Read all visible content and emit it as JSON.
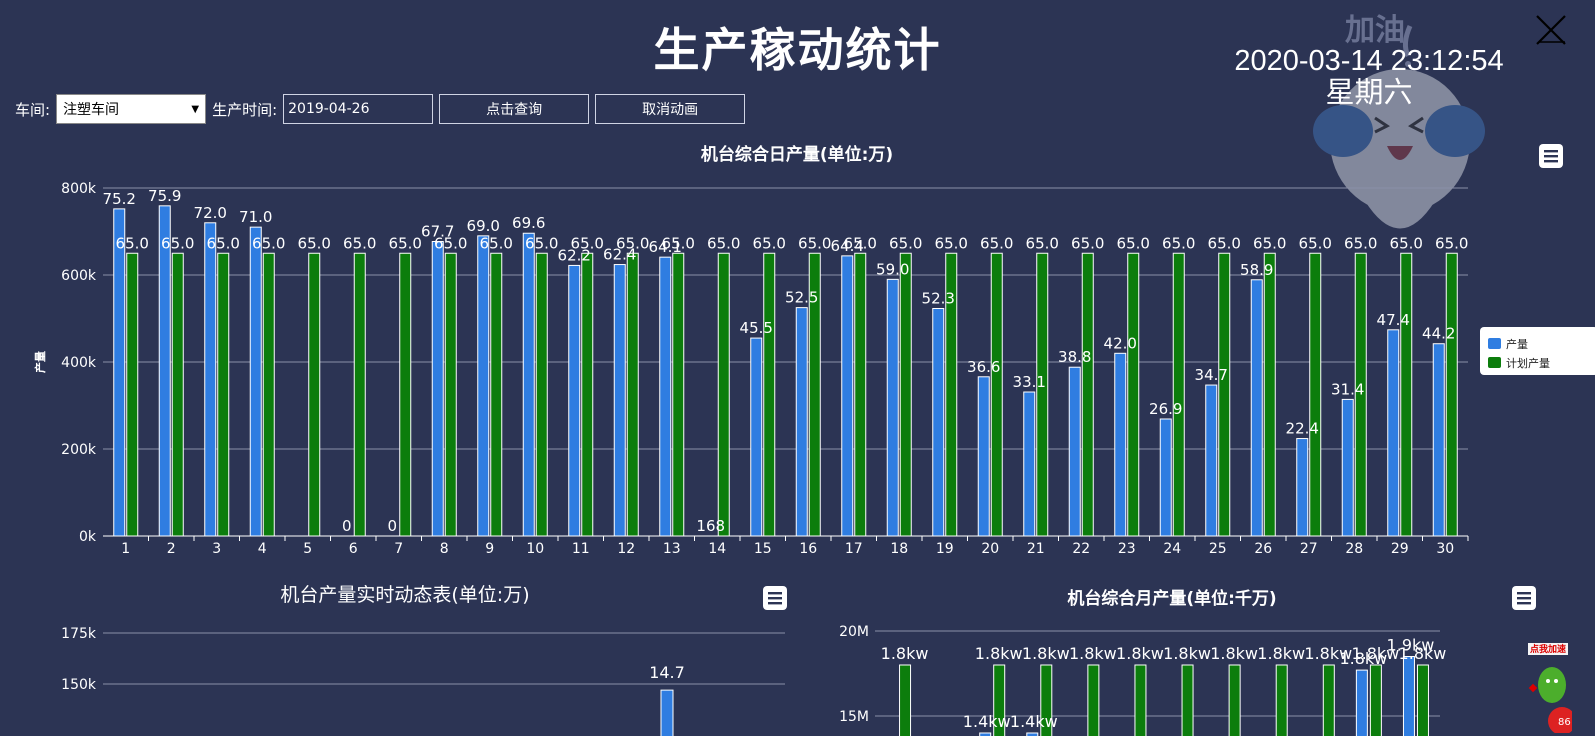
{
  "page": {
    "title": "生产稼动统计",
    "datetime": "2020-03-14 23:12:54",
    "weekday": "星期六"
  },
  "mascot": {
    "text": "加油"
  },
  "toolbar": {
    "workshop_label": "车间:",
    "workshop_value": "注塑车间",
    "date_label": "生产时间:",
    "date_value": "2019-04-26",
    "query_label": "点击查询",
    "cancel_label": "取消动画"
  },
  "ad_badge": {
    "text": "点我加速",
    "number": "86"
  },
  "colors": {
    "background": "#2c3454",
    "output": "#2f7de1",
    "plan": "#0c7d0c",
    "grid": "#8a90a8"
  },
  "chart_data": [
    {
      "type": "bar",
      "title": "机台综合日产量(单位:万)",
      "ylabel": "产量",
      "ylim": [
        0,
        800000
      ],
      "yticks": [
        "0k",
        "200k",
        "400k",
        "600k",
        "800k"
      ],
      "categories": [
        "1",
        "2",
        "3",
        "4",
        "5",
        "6",
        "7",
        "8",
        "9",
        "10",
        "11",
        "12",
        "13",
        "14",
        "15",
        "16",
        "17",
        "18",
        "19",
        "20",
        "21",
        "22",
        "23",
        "24",
        "25",
        "26",
        "27",
        "28",
        "29",
        "30"
      ],
      "legend_position": "right",
      "series": [
        {
          "name": "产量",
          "values": [
            752000,
            759000,
            720000,
            710000,
            0,
            0,
            0,
            677000,
            690000,
            696000,
            622000,
            624000,
            641000,
            168,
            455000,
            525000,
            644000,
            590000,
            523000,
            366000,
            331000,
            388000,
            420000,
            269000,
            347000,
            589000,
            224000,
            314000,
            474000,
            442000
          ],
          "labels": [
            "75.2",
            "75.9",
            "72.0",
            "71.0",
            "",
            "0",
            "0",
            "67.7",
            "69.0",
            "69.6",
            "62.2",
            "62.4",
            "64.1",
            "168",
            "45.5",
            "52.5",
            "64.4",
            "59.0",
            "52.3",
            "36.6",
            "33.1",
            "38.8",
            "42.0",
            "26.9",
            "34.7",
            "58.9",
            "22.4",
            "31.4",
            "47.4",
            "44.2"
          ]
        },
        {
          "name": "计划产量",
          "values": [
            650000,
            650000,
            650000,
            650000,
            650000,
            650000,
            650000,
            650000,
            650000,
            650000,
            650000,
            650000,
            650000,
            650000,
            650000,
            650000,
            650000,
            650000,
            650000,
            650000,
            650000,
            650000,
            650000,
            650000,
            650000,
            650000,
            650000,
            650000,
            650000,
            650000
          ],
          "labels": [
            "65.0",
            "65.0",
            "65.0",
            "65.0",
            "65.0",
            "65.0",
            "65.0",
            "65.0",
            "65.0",
            "65.0",
            "65.0",
            "65.0",
            "65.0",
            "65.0",
            "65.0",
            "65.0",
            "65.0",
            "65.0",
            "65.0",
            "65.0",
            "65.0",
            "65.0",
            "65.0",
            "65.0",
            "65.0",
            "65.0",
            "65.0",
            "65.0",
            "65.0",
            "65.0"
          ]
        }
      ],
      "grid": true
    },
    {
      "type": "bar",
      "title": "机台产量实时动态表(单位:万)",
      "ylim": [
        0,
        175000
      ],
      "yticks": [
        "150k",
        "175k"
      ],
      "visible_bars": [
        {
          "value": 147000,
          "label": "14.7"
        }
      ],
      "grid": true
    },
    {
      "type": "bar",
      "title": "机台综合月产量(单位:千万)",
      "ylim": [
        0,
        20000000
      ],
      "yticks": [
        "15M",
        "20M"
      ],
      "plan_labels": [
        "1.8kw",
        "1.8kw",
        "1.8kw",
        "1.8kw",
        "1.8kw",
        "1.8kw",
        "1.8kw",
        "1.8kw",
        "1.8kw",
        "1.8kw",
        "1.8kw",
        "1.8kw"
      ],
      "plan_values": [
        18000000,
        0,
        18000000,
        18000000,
        18000000,
        18000000,
        18000000,
        18000000,
        18000000,
        18000000,
        18000000,
        18000000
      ],
      "output_labels": [
        "",
        "",
        "1.4kw",
        "1.4kw",
        "",
        "",
        "",
        "",
        "",
        "",
        "1.8kw",
        "1.9kw"
      ],
      "output_values": [
        0,
        0,
        14000000,
        14000000,
        0,
        0,
        0,
        0,
        0,
        0,
        17700000,
        18500000
      ],
      "grid": true
    }
  ]
}
